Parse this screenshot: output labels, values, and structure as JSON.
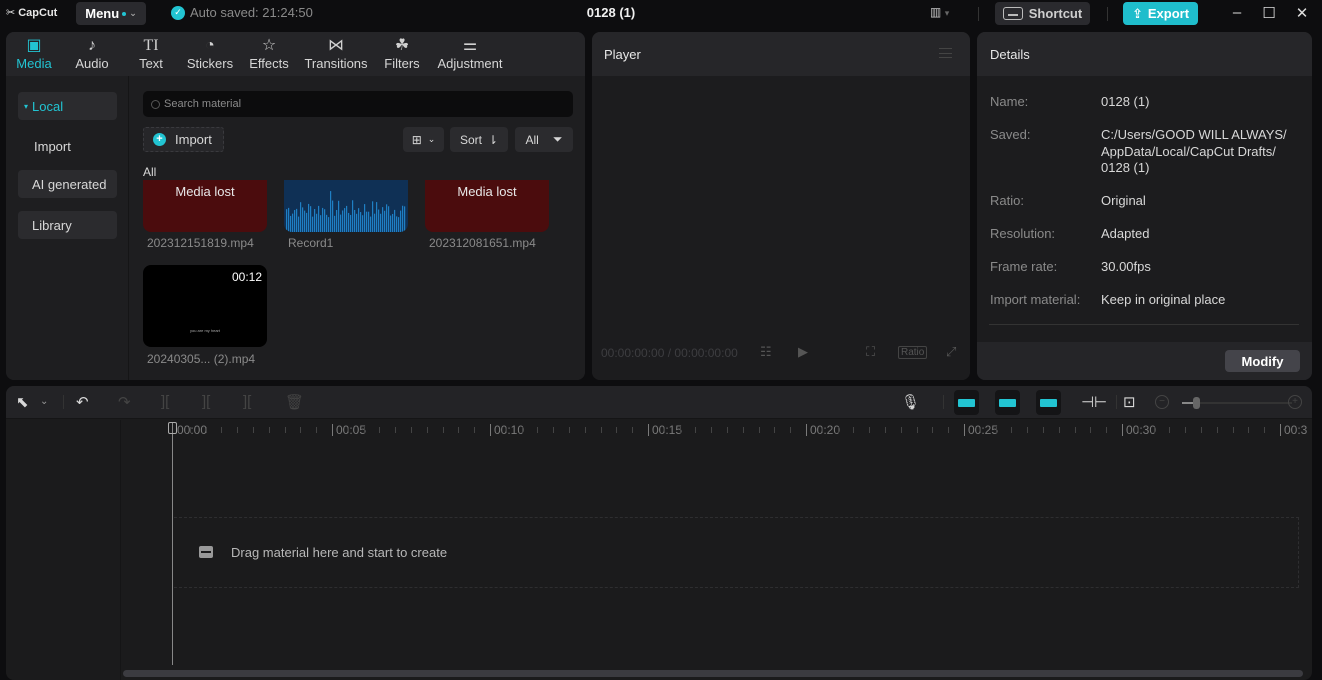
{
  "titlebar": {
    "app_name": "CapCut",
    "menu_label": "Menu",
    "autosave_text": "Auto saved: 21:24:50",
    "project_title": "0128 (1)",
    "shortcut_label": "Shortcut",
    "export_label": "Export",
    "accent_color": "#22c4d2"
  },
  "media": {
    "tabs": [
      {
        "label": "Media",
        "icon": "media-icon",
        "active": true
      },
      {
        "label": "Audio",
        "icon": "audio-icon"
      },
      {
        "label": "Text",
        "icon": "text-icon"
      },
      {
        "label": "Stickers",
        "icon": "stickers-icon"
      },
      {
        "label": "Effects",
        "icon": "effects-icon"
      },
      {
        "label": "Transitions",
        "icon": "transitions-icon"
      },
      {
        "label": "Filters",
        "icon": "filters-icon"
      },
      {
        "label": "Adjustment",
        "icon": "adjustment-icon"
      }
    ],
    "sidenav": [
      {
        "label": "Local",
        "active": true
      },
      {
        "label": "Import"
      },
      {
        "label": "AI generated"
      },
      {
        "label": "Library"
      }
    ],
    "search_placeholder": "Search material",
    "import_label": "Import",
    "sort_label": "Sort",
    "filter_label": "All",
    "section_label": "All",
    "items": [
      {
        "name": "202312151819.mp4",
        "status": "Media lost",
        "type": "video-lost"
      },
      {
        "name": "Record1",
        "type": "audio"
      },
      {
        "name": "202312081651.mp4",
        "status": "Media lost",
        "type": "video-lost"
      },
      {
        "name": "20240305... (2).mp4",
        "duration": "00:12",
        "caption": "you are my heart",
        "type": "video"
      }
    ]
  },
  "player": {
    "title": "Player",
    "timecode": "00:00:00:00 / 00:00:00:00",
    "ratio_label": "Ratio"
  },
  "details": {
    "title": "Details",
    "rows": [
      {
        "key": "Name:",
        "value": "0128 (1)"
      },
      {
        "key": "Saved:",
        "value": "C:/Users/GOOD WILL ALWAYS/ AppData/Local/CapCut Drafts/ 0128 (1)"
      },
      {
        "key": "Ratio:",
        "value": "Original"
      },
      {
        "key": "Resolution:",
        "value": "Adapted"
      },
      {
        "key": "Frame rate:",
        "value": "30.00fps"
      },
      {
        "key": "Import material:",
        "value": "Keep in original place"
      }
    ],
    "modify_label": "Modify"
  },
  "timeline": {
    "ruler_labels": [
      "00:00",
      "00:05",
      "00:10",
      "00:15",
      "00:20",
      "00:25",
      "00:30",
      "00:3"
    ],
    "drop_text": "Drag material here and start to create",
    "zoom_level": 0.1
  }
}
